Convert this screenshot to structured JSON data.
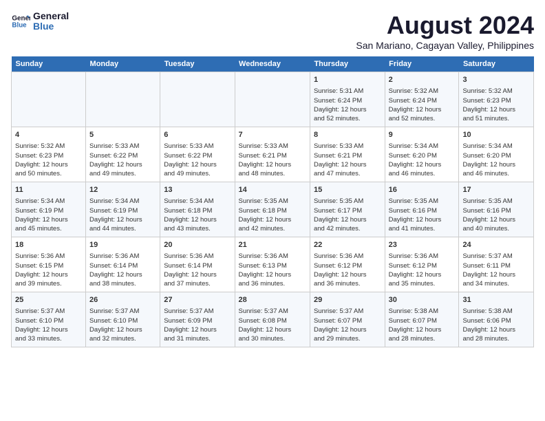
{
  "logo": {
    "line1": "General",
    "line2": "Blue"
  },
  "title": "August 2024",
  "subtitle": "San Mariano, Cagayan Valley, Philippines",
  "headers": [
    "Sunday",
    "Monday",
    "Tuesday",
    "Wednesday",
    "Thursday",
    "Friday",
    "Saturday"
  ],
  "weeks": [
    [
      {
        "day": "",
        "content": ""
      },
      {
        "day": "",
        "content": ""
      },
      {
        "day": "",
        "content": ""
      },
      {
        "day": "",
        "content": ""
      },
      {
        "day": "1",
        "content": "Sunrise: 5:31 AM\nSunset: 6:24 PM\nDaylight: 12 hours\nand 52 minutes."
      },
      {
        "day": "2",
        "content": "Sunrise: 5:32 AM\nSunset: 6:24 PM\nDaylight: 12 hours\nand 52 minutes."
      },
      {
        "day": "3",
        "content": "Sunrise: 5:32 AM\nSunset: 6:23 PM\nDaylight: 12 hours\nand 51 minutes."
      }
    ],
    [
      {
        "day": "4",
        "content": "Sunrise: 5:32 AM\nSunset: 6:23 PM\nDaylight: 12 hours\nand 50 minutes."
      },
      {
        "day": "5",
        "content": "Sunrise: 5:33 AM\nSunset: 6:22 PM\nDaylight: 12 hours\nand 49 minutes."
      },
      {
        "day": "6",
        "content": "Sunrise: 5:33 AM\nSunset: 6:22 PM\nDaylight: 12 hours\nand 49 minutes."
      },
      {
        "day": "7",
        "content": "Sunrise: 5:33 AM\nSunset: 6:21 PM\nDaylight: 12 hours\nand 48 minutes."
      },
      {
        "day": "8",
        "content": "Sunrise: 5:33 AM\nSunset: 6:21 PM\nDaylight: 12 hours\nand 47 minutes."
      },
      {
        "day": "9",
        "content": "Sunrise: 5:34 AM\nSunset: 6:20 PM\nDaylight: 12 hours\nand 46 minutes."
      },
      {
        "day": "10",
        "content": "Sunrise: 5:34 AM\nSunset: 6:20 PM\nDaylight: 12 hours\nand 46 minutes."
      }
    ],
    [
      {
        "day": "11",
        "content": "Sunrise: 5:34 AM\nSunset: 6:19 PM\nDaylight: 12 hours\nand 45 minutes."
      },
      {
        "day": "12",
        "content": "Sunrise: 5:34 AM\nSunset: 6:19 PM\nDaylight: 12 hours\nand 44 minutes."
      },
      {
        "day": "13",
        "content": "Sunrise: 5:34 AM\nSunset: 6:18 PM\nDaylight: 12 hours\nand 43 minutes."
      },
      {
        "day": "14",
        "content": "Sunrise: 5:35 AM\nSunset: 6:18 PM\nDaylight: 12 hours\nand 42 minutes."
      },
      {
        "day": "15",
        "content": "Sunrise: 5:35 AM\nSunset: 6:17 PM\nDaylight: 12 hours\nand 42 minutes."
      },
      {
        "day": "16",
        "content": "Sunrise: 5:35 AM\nSunset: 6:16 PM\nDaylight: 12 hours\nand 41 minutes."
      },
      {
        "day": "17",
        "content": "Sunrise: 5:35 AM\nSunset: 6:16 PM\nDaylight: 12 hours\nand 40 minutes."
      }
    ],
    [
      {
        "day": "18",
        "content": "Sunrise: 5:36 AM\nSunset: 6:15 PM\nDaylight: 12 hours\nand 39 minutes."
      },
      {
        "day": "19",
        "content": "Sunrise: 5:36 AM\nSunset: 6:14 PM\nDaylight: 12 hours\nand 38 minutes."
      },
      {
        "day": "20",
        "content": "Sunrise: 5:36 AM\nSunset: 6:14 PM\nDaylight: 12 hours\nand 37 minutes."
      },
      {
        "day": "21",
        "content": "Sunrise: 5:36 AM\nSunset: 6:13 PM\nDaylight: 12 hours\nand 36 minutes."
      },
      {
        "day": "22",
        "content": "Sunrise: 5:36 AM\nSunset: 6:12 PM\nDaylight: 12 hours\nand 36 minutes."
      },
      {
        "day": "23",
        "content": "Sunrise: 5:36 AM\nSunset: 6:12 PM\nDaylight: 12 hours\nand 35 minutes."
      },
      {
        "day": "24",
        "content": "Sunrise: 5:37 AM\nSunset: 6:11 PM\nDaylight: 12 hours\nand 34 minutes."
      }
    ],
    [
      {
        "day": "25",
        "content": "Sunrise: 5:37 AM\nSunset: 6:10 PM\nDaylight: 12 hours\nand 33 minutes."
      },
      {
        "day": "26",
        "content": "Sunrise: 5:37 AM\nSunset: 6:10 PM\nDaylight: 12 hours\nand 32 minutes."
      },
      {
        "day": "27",
        "content": "Sunrise: 5:37 AM\nSunset: 6:09 PM\nDaylight: 12 hours\nand 31 minutes."
      },
      {
        "day": "28",
        "content": "Sunrise: 5:37 AM\nSunset: 6:08 PM\nDaylight: 12 hours\nand 30 minutes."
      },
      {
        "day": "29",
        "content": "Sunrise: 5:37 AM\nSunset: 6:07 PM\nDaylight: 12 hours\nand 29 minutes."
      },
      {
        "day": "30",
        "content": "Sunrise: 5:38 AM\nSunset: 6:07 PM\nDaylight: 12 hours\nand 28 minutes."
      },
      {
        "day": "31",
        "content": "Sunrise: 5:38 AM\nSunset: 6:06 PM\nDaylight: 12 hours\nand 28 minutes."
      }
    ]
  ]
}
